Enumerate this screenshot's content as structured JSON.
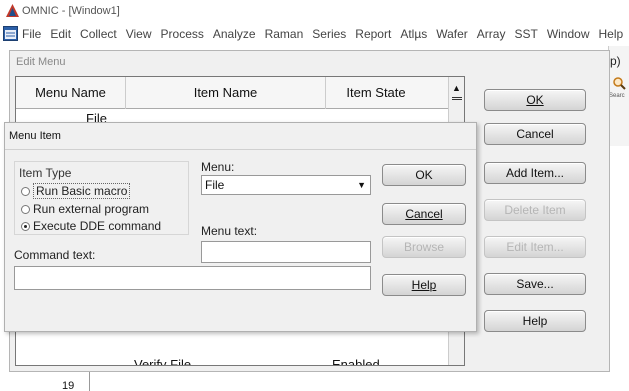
{
  "app": {
    "title": "OMNIC - [Window1]",
    "menu": [
      "File",
      "Edit",
      "Collect",
      "View",
      "Process",
      "Analyze",
      "Raman",
      "Series",
      "Report",
      "Atlµs",
      "Wafer",
      "Array",
      "SST",
      "Window",
      "Help"
    ],
    "right_fragment": "p)",
    "search_label": "Searc",
    "row_number": "19"
  },
  "edit_menu": {
    "title": "Edit Menu",
    "columns": [
      "Menu Name",
      "Item Name",
      "Item State"
    ],
    "rows": [
      {
        "menu": "File",
        "item": "",
        "state": ""
      },
      {
        "menu": "",
        "item": "Verify File...",
        "state": "Enabled"
      }
    ],
    "buttons": {
      "ok": "OK",
      "cancel": "Cancel",
      "add_item": "Add Item...",
      "delete_item": "Delete Item",
      "edit_item": "Edit Item...",
      "save": "Save...",
      "help": "Help"
    }
  },
  "menu_item": {
    "title": "Menu Item",
    "item_type_label": "Item Type",
    "options": [
      "Run Basic macro",
      "Run external program",
      "Execute DDE command"
    ],
    "selected_option": "Execute DDE command",
    "menu_label": "Menu:",
    "menu_value": "File",
    "menu_text_label": "Menu text:",
    "menu_text_value": "",
    "command_text_label": "Command text:",
    "command_text_value": "",
    "buttons": {
      "ok": "OK",
      "cancel": "Cancel",
      "browse": "Browse",
      "help": "Help"
    }
  }
}
